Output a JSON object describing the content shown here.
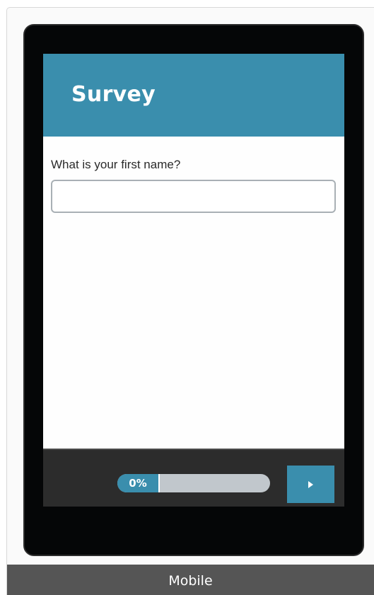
{
  "survey": {
    "title": "Survey",
    "question": "What is your first name?",
    "answer_value": "",
    "answer_placeholder": ""
  },
  "footer": {
    "progress_percent": 0,
    "progress_label": "0%",
    "next_icon": "play-arrow-icon"
  },
  "caption": {
    "label": "Mobile"
  },
  "colors": {
    "accent": "#3a8ead",
    "device": "#050607",
    "footer": "#2c2c2c",
    "progress_track": "#c1c7cc",
    "caption": "#555555"
  }
}
